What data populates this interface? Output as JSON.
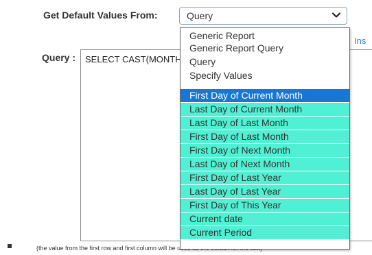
{
  "form": {
    "default_values_label": "Get Default Values From:",
    "select_value": "Query",
    "ins_link": "Ins",
    "query_label": "Query :",
    "query_text": "SELECT CAST(MONTH(GETDATE()) AS VARCHAR(MAX))",
    "hint_text": "(the value from the first row and first column will be used as the default for the text)"
  },
  "dropdown": {
    "options": [
      "Generic Report",
      "Generic Report Query",
      "Query",
      "Specify Values",
      "First Day of Current Month",
      "Last Day of Current Month",
      "Last Day of Last Month",
      "First Day of Last Month",
      "First Day of Next Month",
      "Last Day of Next Month",
      "First Day of Last Year",
      "Last Day of Last Year",
      "First Day of This Year",
      "Current date",
      "Current Period"
    ],
    "selected_index": 4,
    "highlight_start": 4
  },
  "colors": {
    "selected_bg": "#1a76d2",
    "highlight_bg": "#4ff0d3",
    "link": "#3a7fc4"
  },
  "icons": {
    "select_arrow": "chevron-down-icon",
    "bullet": "square-bullet-icon"
  }
}
